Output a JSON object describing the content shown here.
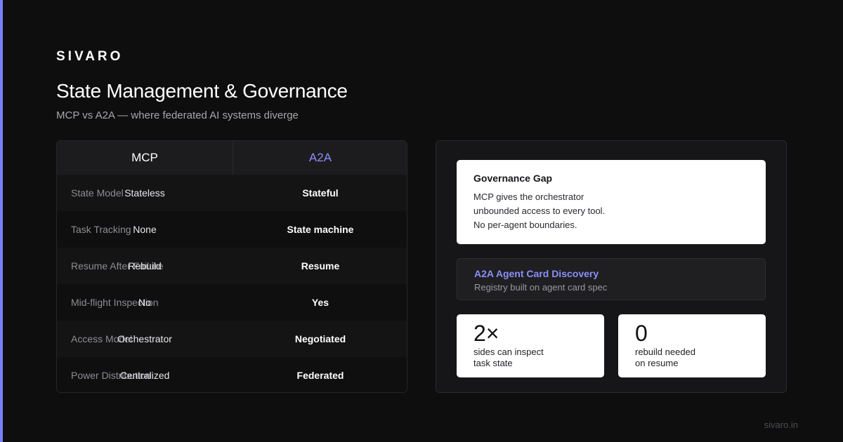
{
  "brand": "SIVARO",
  "title": "State Management & Governance",
  "subtitle": "MCP vs A2A — where federated AI systems diverge",
  "colors": {
    "accent": "#7b7ff7",
    "a2a": "#8b8ff8",
    "background": "#0e0e0f"
  },
  "table": {
    "headers": {
      "mcp": "MCP",
      "a2a": "A2A"
    },
    "rows": [
      {
        "label": "State Model",
        "mcp": "Stateless",
        "a2a": "Stateful"
      },
      {
        "label": "Task Tracking",
        "mcp": "None",
        "a2a": "State machine"
      },
      {
        "label": "Resume After Failure",
        "mcp": "Rebuild",
        "a2a": "Resume"
      },
      {
        "label": "Mid-flight Inspection",
        "mcp": "No",
        "a2a": "Yes"
      },
      {
        "label": "Access Model",
        "mcp": "Orchestrator",
        "a2a": "Negotiated"
      },
      {
        "label": "Power Distribution",
        "mcp": "Centralized",
        "a2a": "Federated"
      }
    ]
  },
  "governance": {
    "title": "Governance Gap",
    "lines": [
      "MCP gives the orchestrator",
      "unbounded access to every tool.",
      "No per-agent boundaries."
    ]
  },
  "discovery": {
    "title": "A2A Agent Card Discovery",
    "subtitle": "Registry built on agent card spec"
  },
  "stats": [
    {
      "value": "2×",
      "lines": [
        "sides can inspect",
        "task state"
      ]
    },
    {
      "value": "0",
      "lines": [
        "rebuild needed",
        "on resume"
      ]
    }
  ],
  "footer": "sivaro.in"
}
